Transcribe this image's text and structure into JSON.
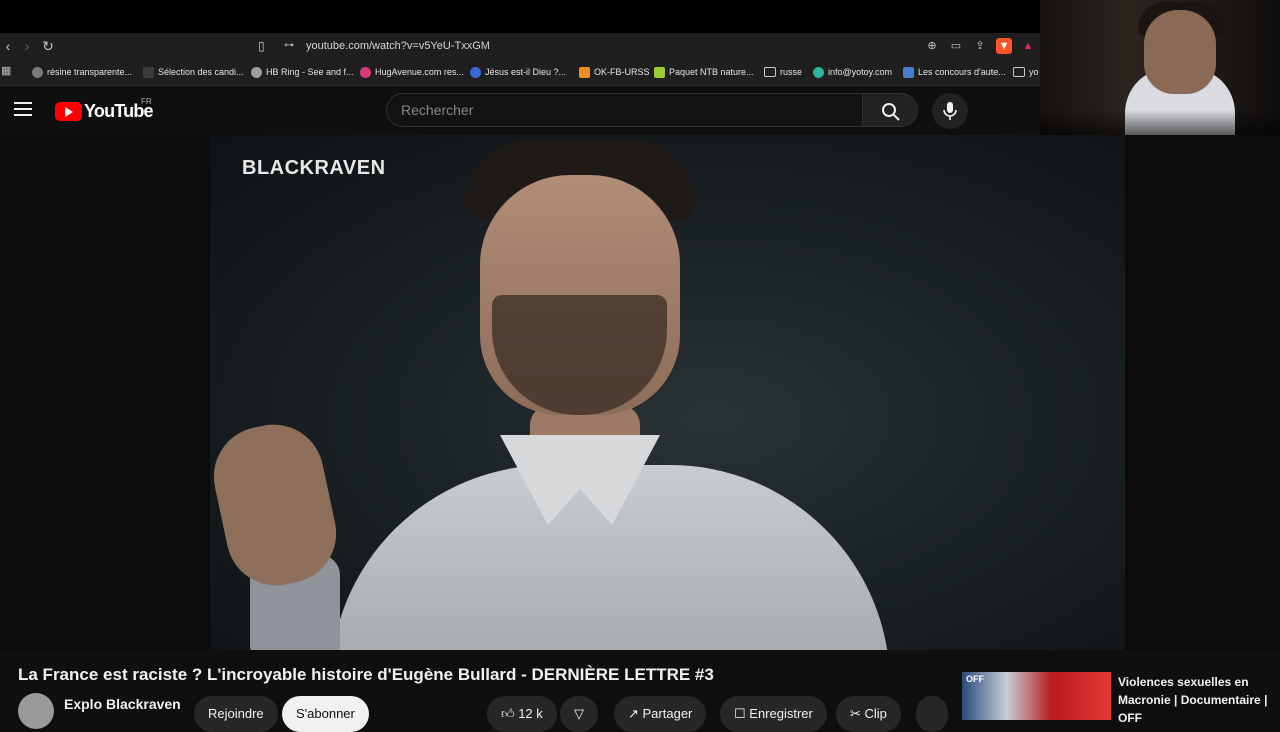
{
  "browser": {
    "url": "youtube.com/watch?v=v5YeU-TxxGM",
    "bookmarks": [
      {
        "label": "résine transparente...",
        "color": "#7a7a7a"
      },
      {
        "label": "Sélection des candi...",
        "color": "#3b3b3b"
      },
      {
        "label": "HB Ring - See and f...",
        "color": "#9e9e9e"
      },
      {
        "label": "HugAvenue.com res...",
        "color": "#d93a7b"
      },
      {
        "label": "Jésus est-il Dieu ?...",
        "color": "#3a6ad9"
      },
      {
        "label": "OK-FB-URSS",
        "color": "#f28b20"
      },
      {
        "label": "Paquet NTB nature...",
        "color": "#9acd32"
      },
      {
        "label": "russe",
        "color": "#1f1f1f"
      },
      {
        "label": "info@yotoy.com",
        "color": "#2db3a0"
      },
      {
        "label": "Les concours d'aute...",
        "color": "#4a7fc8"
      },
      {
        "label": "yo",
        "color": "#1f1f1f"
      }
    ]
  },
  "youtube": {
    "logo_text": "YouTube",
    "region": "FR",
    "search_placeholder": "Rechercher"
  },
  "video": {
    "watermark": "BLACKRAVEN",
    "title": "La France est raciste ? L'incroyable histoire d'Eugène Bullard - DERNIÈRE LETTRE #3",
    "channel": "Explo Blackraven",
    "join_label": "Rejoindre",
    "subscribe_label": "S'abonner",
    "likes": "12 k",
    "share_label": "Partager",
    "save_label": "Enregistrer",
    "clip_label": "Clip"
  },
  "recommendation": {
    "badge": "OFF",
    "title": "Violences sexuelles en Macronie | Documentaire | OFF"
  },
  "colors": {
    "background": "#0f0f0f",
    "brand_red": "#ff0000",
    "toolbar": "#1f1f1f"
  }
}
